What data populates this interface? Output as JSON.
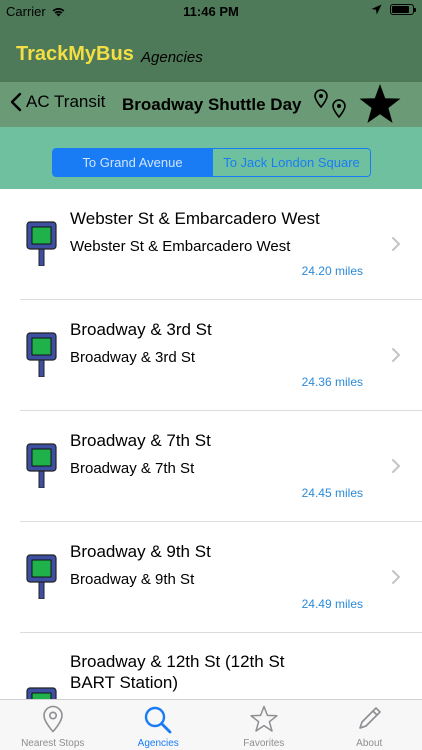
{
  "status_bar": {
    "carrier": "Carrier",
    "time": "11:46 PM",
    "battery_level": 0.85
  },
  "header": {
    "app_title": "TrackMyBus",
    "agencies_link": "Agencies",
    "title_color": "#f3df43",
    "bar_color": "#4e7a59"
  },
  "route": {
    "back_label": "AC Transit",
    "title": "Broadway Shuttle Day",
    "pins_icon": "map-pins-icon",
    "favorite_icon": "star-icon"
  },
  "direction": {
    "options": [
      "To Grand Avenue",
      "To Jack London Square"
    ],
    "selected": "To Grand Avenue",
    "accent_color": "#1a7cf5",
    "background_color": "#6fc09f"
  },
  "stops": [
    {
      "name": "Webster St & Embarcadero West",
      "subtitle": "Webster St & Embarcadero West",
      "distance": "24.20 miles"
    },
    {
      "name": "Broadway & 3rd St",
      "subtitle": "Broadway & 3rd St",
      "distance": "24.36 miles"
    },
    {
      "name": "Broadway & 7th St",
      "subtitle": "Broadway & 7th St",
      "distance": "24.45 miles"
    },
    {
      "name": "Broadway & 9th St",
      "subtitle": "Broadway & 9th St",
      "distance": "24.49 miles"
    },
    {
      "name": "Broadway & 12th St (12th St BART Station)",
      "subtitle": "",
      "distance": ""
    }
  ],
  "tab_bar": {
    "tabs": [
      {
        "label": "Nearest Stops",
        "icon": "location-pin-icon"
      },
      {
        "label": "Agencies",
        "icon": "search-icon"
      },
      {
        "label": "Favorites",
        "icon": "star-outline-icon"
      },
      {
        "label": "About",
        "icon": "pencil-icon"
      }
    ],
    "active": "Agencies",
    "active_color": "#1a7cf5"
  }
}
